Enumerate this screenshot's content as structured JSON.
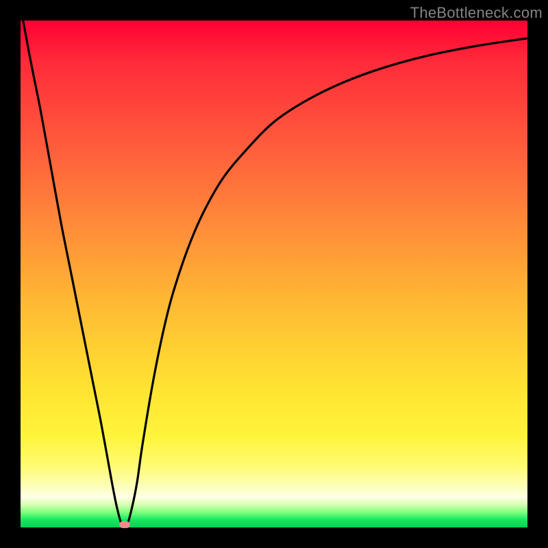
{
  "watermark": "TheBottleneck.com",
  "chart_data": {
    "type": "line",
    "title": "",
    "xlabel": "",
    "ylabel": "",
    "xlim": [
      0,
      100
    ],
    "ylim": [
      0,
      100
    ],
    "grid": false,
    "legend": false,
    "background_gradient": [
      {
        "stop": 0,
        "color": "#ff0033"
      },
      {
        "stop": 40,
        "color": "#ff8a3a"
      },
      {
        "stop": 72,
        "color": "#ffe231"
      },
      {
        "stop": 92,
        "color": "#fcffc4"
      },
      {
        "stop": 100,
        "color": "#02d352"
      }
    ],
    "series": [
      {
        "name": "bottleneck-curve",
        "color": "#000000",
        "x": [
          0.5,
          2,
          4,
          6,
          8,
          10,
          12,
          14,
          16,
          18,
          19,
          20,
          21,
          22,
          23,
          24,
          26,
          28,
          30,
          33,
          36,
          40,
          45,
          50,
          56,
          63,
          71,
          80,
          90,
          100
        ],
        "y": [
          100,
          92,
          82,
          71,
          60,
          50,
          40,
          30,
          20,
          9,
          4,
          0.5,
          0.5,
          4,
          9,
          16,
          28,
          38,
          46,
          55,
          62,
          69,
          75,
          80,
          84,
          87.5,
          90.5,
          93,
          95,
          96.5
        ]
      }
    ],
    "marker": {
      "name": "optimal-point",
      "color": "#f28a8a",
      "x": 20.5,
      "y": 0.5
    }
  }
}
